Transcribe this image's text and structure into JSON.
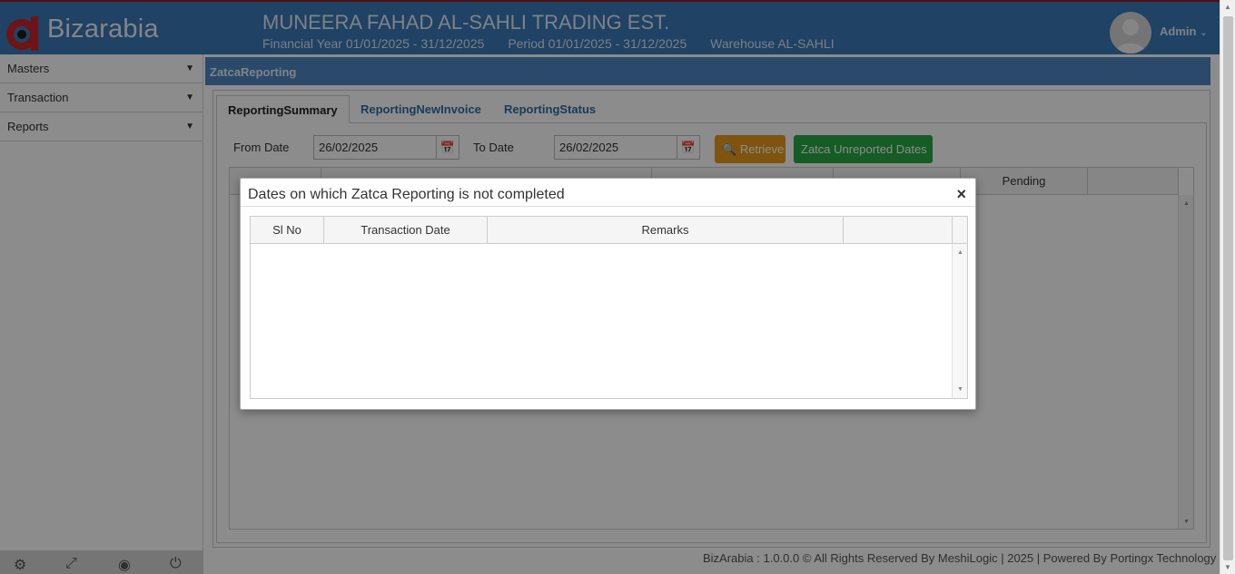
{
  "header": {
    "brand": "Bizarabia",
    "company": "MUNEERA FAHAD AL-SAHLI TRADING EST.",
    "financial_year": "Financial Year 01/01/2025 - 31/12/2025",
    "period": "Period 01/01/2025 - 31/12/2025",
    "warehouse": "Warehouse AL-SAHLI",
    "user": "Admin"
  },
  "sidebar": {
    "items": [
      {
        "label": "Masters"
      },
      {
        "label": "Transaction"
      },
      {
        "label": "Reports"
      }
    ],
    "footer_icons": [
      "settings-icon",
      "fullscreen-icon",
      "visibility-icon",
      "power-icon"
    ]
  },
  "panel": {
    "title": "ZatcaReporting",
    "tabs": [
      {
        "label": "ReportingSummary",
        "active": true
      },
      {
        "label": "ReportingNewInvoice",
        "active": false
      },
      {
        "label": "ReportingStatus",
        "active": false
      }
    ],
    "filters": {
      "from_label": "From Date",
      "from_value": "26/02/2025",
      "to_label": "To Date",
      "to_value": "26/02/2025"
    },
    "buttons": {
      "retrieve": "Retrieve",
      "zatca_unreported": "Zatca Unreported Dates"
    },
    "grid_columns": [
      "",
      "",
      "",
      "",
      "Pending",
      ""
    ]
  },
  "modal": {
    "title": "Dates on which Zatca Reporting is not completed",
    "close": "×",
    "columns": [
      "Sl No",
      "Transaction Date",
      "Remarks",
      ""
    ]
  },
  "footer": {
    "text": "BizArabia : 1.0.0.0 © All Rights Reserved By MeshiLogic | 2025 | Powered By Portingx Technology"
  },
  "colors": {
    "header_bg": "#3a78b8",
    "panel_head_bg": "#4d86c4",
    "retrieve_bg": "#e69a1b",
    "zatca_bg": "#27a844",
    "tab_link": "#2d6da7"
  }
}
